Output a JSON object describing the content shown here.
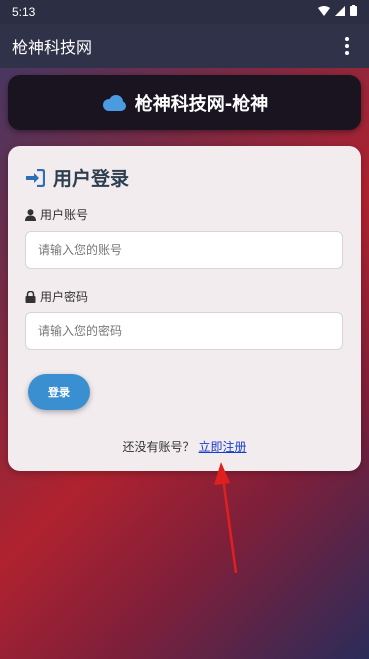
{
  "status_bar": {
    "time": "5:13"
  },
  "app_bar": {
    "title": "枪神科技网"
  },
  "banner": {
    "text": "枪神科技网-枪神"
  },
  "login_card": {
    "title": "用户登录",
    "username": {
      "label": "用户账号",
      "placeholder": "请输入您的账号",
      "value": ""
    },
    "password": {
      "label": "用户密码",
      "placeholder": "请输入您的密码",
      "value": ""
    },
    "login_button": "登录",
    "register_prompt": "还没有账号？",
    "register_link": "立即注册"
  },
  "colors": {
    "accent": "#3a8fd0",
    "card_bg": "#f2ecef",
    "app_bar": "#2f3248",
    "link": "#1a3ccc",
    "annotation_arrow": "#e0201e"
  }
}
